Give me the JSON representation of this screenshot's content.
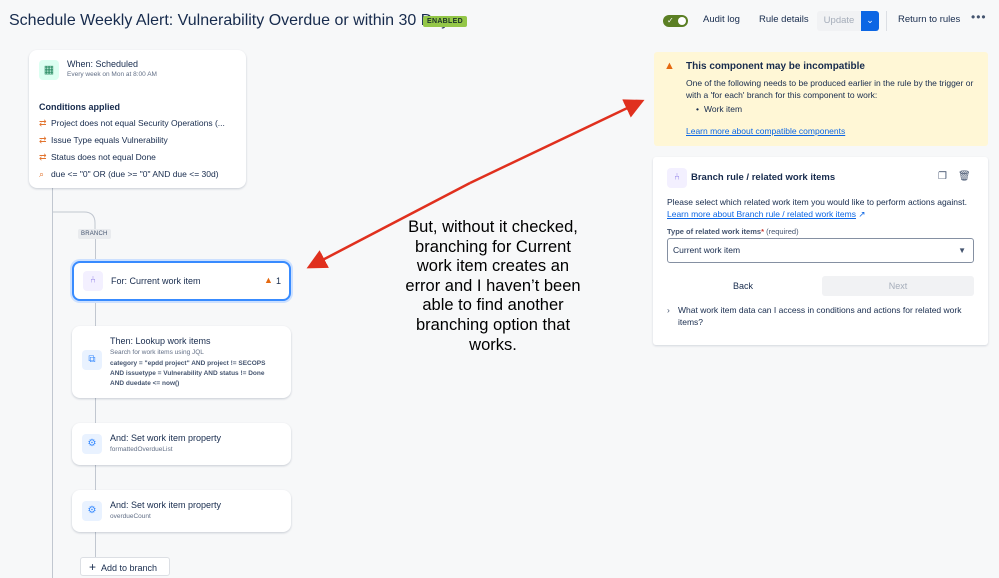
{
  "header": {
    "title": "Schedule Weekly Alert: Vulnerability Overdue or within 30 Days",
    "status_badge": "ENABLED",
    "toggle_on": true,
    "audit_log": "Audit log",
    "rule_details": "Rule details",
    "update": "Update",
    "return_to_rules": "Return to rules",
    "more": "•••"
  },
  "trigger": {
    "title": "When: Scheduled",
    "subtitle": "Every week on Mon at 8:00 AM",
    "conditions_heading": "Conditions applied",
    "conditions": [
      "Project does not equal Security Operations (...",
      "Issue Type equals Vulnerability",
      "Status does not equal Done",
      "due <= \"0\" OR (due >= \"0\" AND due <= 30d)"
    ]
  },
  "branch": {
    "tag": "BRANCH",
    "for_title": "For: Current work item",
    "warning_count": "1",
    "lookup_title": "Then: Lookup work items",
    "lookup_sub": "Search for work items using JQL",
    "lookup_jql": "category = \"epdd project\" AND project != SECOPS AND issuetype = Vulnerability AND status != Done AND duedate <= now()",
    "set1_title": "And: Set work item property",
    "set1_sub": "formattedOverdueList",
    "set2_title": "And: Set work item property",
    "set2_sub": "overdueCount",
    "add_to_branch": "Add to branch"
  },
  "annotation": {
    "text": "But, without it checked, branching for Current work item creates an error and I haven’t been able to find another branching option that works."
  },
  "warning_panel": {
    "title": "This component may be incompatible",
    "body": "One of the following needs to be produced earlier in the rule by the trigger or with a 'for each' branch for this component to work:",
    "item": "Work item",
    "link": "Learn more about compatible components"
  },
  "config_panel": {
    "title": "Branch rule / related work items",
    "desc_text": "Please select which related work item you would like to perform actions against.",
    "desc_link": "Learn more about Branch rule / related work items",
    "field_label": "Type of related work items",
    "field_required_mark": "*",
    "field_required_text": "(required)",
    "field_value": "Current work item",
    "back": "Back",
    "next": "Next",
    "faq": "What work item data can I access in conditions and actions for related work items?"
  },
  "colors": {
    "accent": "#0c66e4",
    "warning_bg": "#fff7d6",
    "badge_green": "#94c748",
    "toggle_green": "#5b7f24",
    "arrow_red": "#e0301e"
  }
}
